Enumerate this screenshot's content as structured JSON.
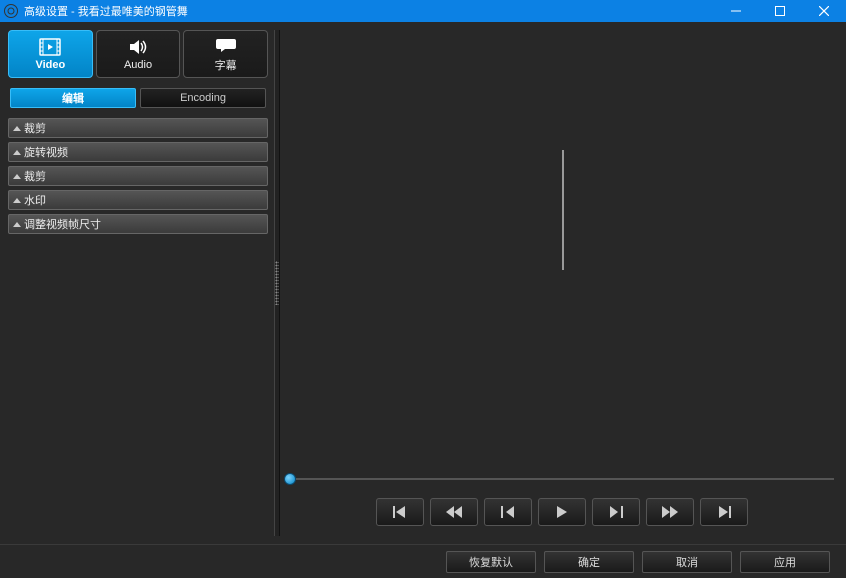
{
  "titlebar": {
    "title": "高级设置 - 我看过最唯美的钢管舞"
  },
  "topTabs": {
    "video": "Video",
    "audio": "Audio",
    "subtitle": "字幕"
  },
  "subTabs": {
    "edit": "编辑",
    "encoding": "Encoding"
  },
  "accordion": {
    "crop": "裁剪",
    "rotate": "旋转视频",
    "crop2": "裁剪",
    "watermark": "水印",
    "resize": "调整视频帧尺寸"
  },
  "bottomButtons": {
    "restore": "恢复默认",
    "ok": "确定",
    "cancel": "取消",
    "apply": "应用"
  }
}
